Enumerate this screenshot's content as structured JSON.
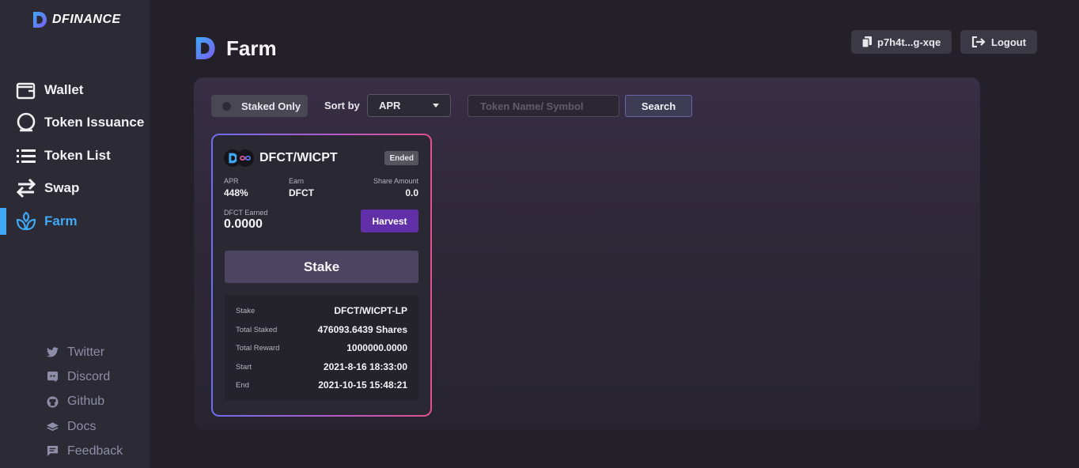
{
  "brand": {
    "name": "DFINANCE"
  },
  "sidebar": {
    "items": [
      {
        "label": "Wallet",
        "icon": "wallet-icon"
      },
      {
        "label": "Token Issuance",
        "icon": "coin-icon"
      },
      {
        "label": "Token List",
        "icon": "list-icon"
      },
      {
        "label": "Swap",
        "icon": "swap-icon"
      },
      {
        "label": "Farm",
        "icon": "farm-icon",
        "active": true
      }
    ],
    "social": [
      {
        "label": "Twitter",
        "icon": "twitter-icon"
      },
      {
        "label": "Discord",
        "icon": "discord-icon"
      },
      {
        "label": "Github",
        "icon": "github-icon"
      },
      {
        "label": "Docs",
        "icon": "docs-icon"
      },
      {
        "label": "Feedback",
        "icon": "feedback-icon"
      }
    ]
  },
  "header": {
    "title": "Farm",
    "account": "p7h4t...g-xqe",
    "logout": "Logout"
  },
  "filters": {
    "staked_only": "Staked Only",
    "staked_only_on": false,
    "sort_label": "Sort by",
    "sort_value": "APR",
    "search_placeholder": "Token Name/ Symbol",
    "search_value": "",
    "search_button": "Search"
  },
  "farm": {
    "pair": "DFCT/WICPT",
    "status": "Ended",
    "apr_label": "APR",
    "apr": "448%",
    "earn_label": "Earn",
    "earn": "DFCT",
    "share_label": "Share Amount",
    "share": "0.0",
    "earned_label": "DFCT Earned",
    "earned": "0.0000",
    "harvest": "Harvest",
    "stake_button": "Stake",
    "details": [
      {
        "key": "Stake",
        "value": "DFCT/WICPT-LP"
      },
      {
        "key": "Total Staked",
        "value": "476093.6439 Shares"
      },
      {
        "key": "Total Reward",
        "value": "1000000.0000"
      },
      {
        "key": "Start",
        "value": "2021-8-16 18:33:00"
      },
      {
        "key": "End",
        "value": "2021-10-15 15:48:21"
      }
    ]
  },
  "colors": {
    "accent": "#3fa9f5",
    "harvest": "#6130a8",
    "card_border_start": "#6c6ef0",
    "card_border_end": "#e24f8c"
  }
}
